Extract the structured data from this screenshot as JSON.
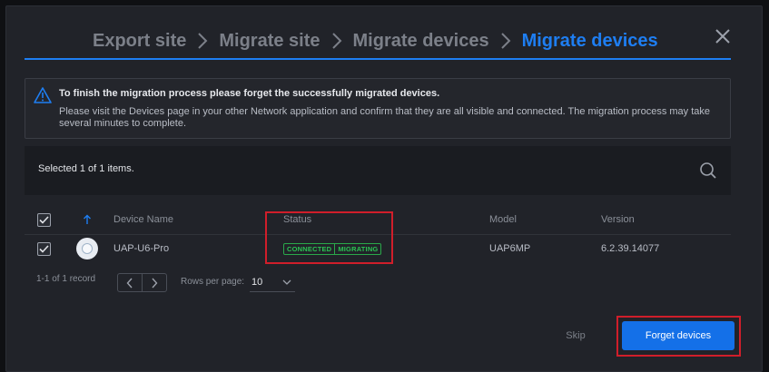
{
  "breadcrumb": {
    "steps": [
      "Export site",
      "Migrate site",
      "Migrate devices",
      "Migrate devices"
    ]
  },
  "banner": {
    "title": "To finish the migration process please forget the successfully migrated devices.",
    "body": "Please visit the Devices page in your other Network application and confirm that they are all visible and connected. The migration process may take several minutes to complete."
  },
  "selection": {
    "text": "Selected 1 of 1 items."
  },
  "table": {
    "columns": [
      "Device Name",
      "Status",
      "Model",
      "Version"
    ],
    "rows": [
      {
        "device_name": "UAP-U6-Pro",
        "status": [
          "CONNECTED",
          "MIGRATING"
        ],
        "model": "UAP6MP",
        "version": "6.2.39.14077"
      }
    ]
  },
  "pagination": {
    "range": "1-1 of 1 record",
    "rows_per_page_label": "Rows per page:",
    "rows_per_page": "10"
  },
  "footer": {
    "skip_label": "Skip",
    "forget_label": "Forget devices"
  },
  "colors": {
    "accent": "#1e7ef2",
    "status_green": "#2bc353",
    "highlight_red": "#d01e2a",
    "background": "#212329"
  }
}
